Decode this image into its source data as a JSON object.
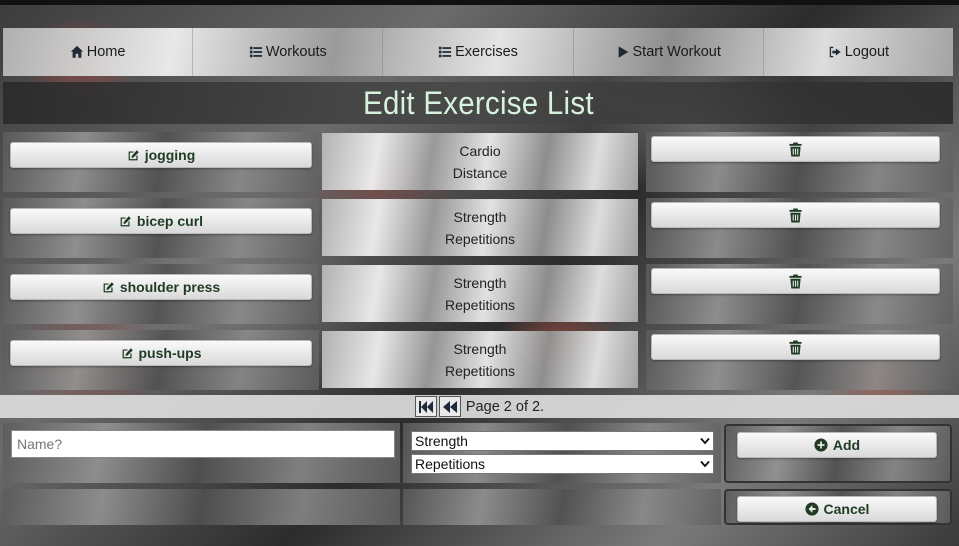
{
  "nav": {
    "items": [
      {
        "label": "Home",
        "icon": "home-icon"
      },
      {
        "label": "Workouts",
        "icon": "list-icon"
      },
      {
        "label": "Exercises",
        "icon": "list-icon"
      },
      {
        "label": "Start Workout",
        "icon": "play-icon"
      },
      {
        "label": "Logout",
        "icon": "sign-out-icon"
      }
    ]
  },
  "page": {
    "title": "Edit Exercise List"
  },
  "exercises": [
    {
      "name": "jogging",
      "category": "Cardio",
      "measure": "Distance"
    },
    {
      "name": "bicep curl",
      "category": "Strength",
      "measure": "Repetitions"
    },
    {
      "name": "shoulder press",
      "category": "Strength",
      "measure": "Repetitions"
    },
    {
      "name": "push-ups",
      "category": "Strength",
      "measure": "Repetitions"
    }
  ],
  "pagination": {
    "text": "Page 2 of 2."
  },
  "form": {
    "name_placeholder": "Name?",
    "name_value": "",
    "category_selected": "Strength",
    "measure_selected": "Repetitions",
    "add_label": "Add",
    "cancel_label": "Cancel"
  },
  "colors": {
    "title_text": "#d7f2dc",
    "button_text": "#1f3b24"
  }
}
